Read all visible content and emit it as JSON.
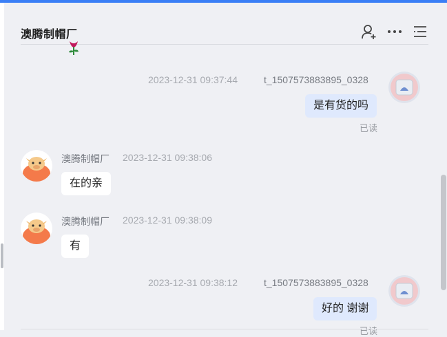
{
  "header": {
    "title": "澳腾制帽厂",
    "icons": [
      "add-contact-icon",
      "more-icon",
      "menu-list-icon"
    ]
  },
  "messages": [
    {
      "side": "self",
      "sender": "t_1507573883895_0328",
      "time": "2023-12-31 09:37:44",
      "text": "是有货的吗",
      "status": "已读"
    },
    {
      "side": "other",
      "sender": "澳腾制帽厂",
      "time": "2023-12-31 09:38:06",
      "text": "在的亲"
    },
    {
      "side": "other",
      "sender": "澳腾制帽厂",
      "time": "2023-12-31 09:38:09",
      "text": "有"
    },
    {
      "side": "self",
      "sender": "t_1507573883895_0328",
      "time": "2023-12-31 09:38:12",
      "text": "好的 谢谢",
      "status": "已读"
    }
  ],
  "colors": {
    "accent": "#3a7ff6",
    "self_bubble": "#dfe9fd",
    "other_bubble": "#ffffff",
    "background": "#eff0f4"
  }
}
